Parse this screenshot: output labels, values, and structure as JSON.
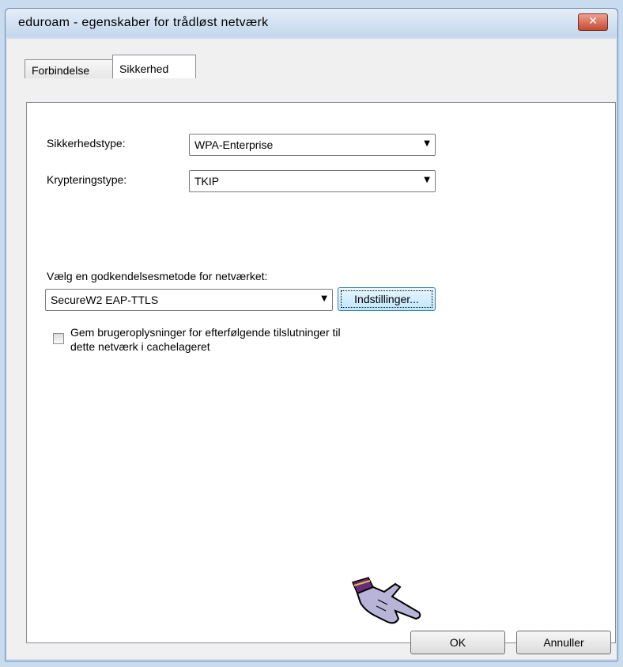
{
  "window": {
    "title": "eduroam - egenskaber for trådløst netværk",
    "close_glyph": "✕"
  },
  "tabs": [
    {
      "label": "Forbindelse",
      "active": false
    },
    {
      "label": "Sikkerhed",
      "active": true
    }
  ],
  "security": {
    "type_label": "Sikkerhedstype:",
    "type_value": "WPA-Enterprise",
    "encryption_label": "Krypteringstype:",
    "encryption_value": "TKIP"
  },
  "auth": {
    "label": "Vælg en godkendelsesmetode for netværket:",
    "method_value": "SecureW2 EAP-TTLS",
    "settings_button": "Indstillinger..."
  },
  "cache_checkbox": {
    "line1": "Gem brugeroplysninger for efterfølgende tilslutninger til",
    "line2": "dette netværk i cachelageret",
    "checked": false
  },
  "footer": {
    "ok_label": "OK",
    "cancel_label": "Annuller"
  },
  "icons": {
    "cursor": "pointing-hand-icon",
    "dropdown": "chevron-down-icon",
    "close": "close-icon"
  }
}
